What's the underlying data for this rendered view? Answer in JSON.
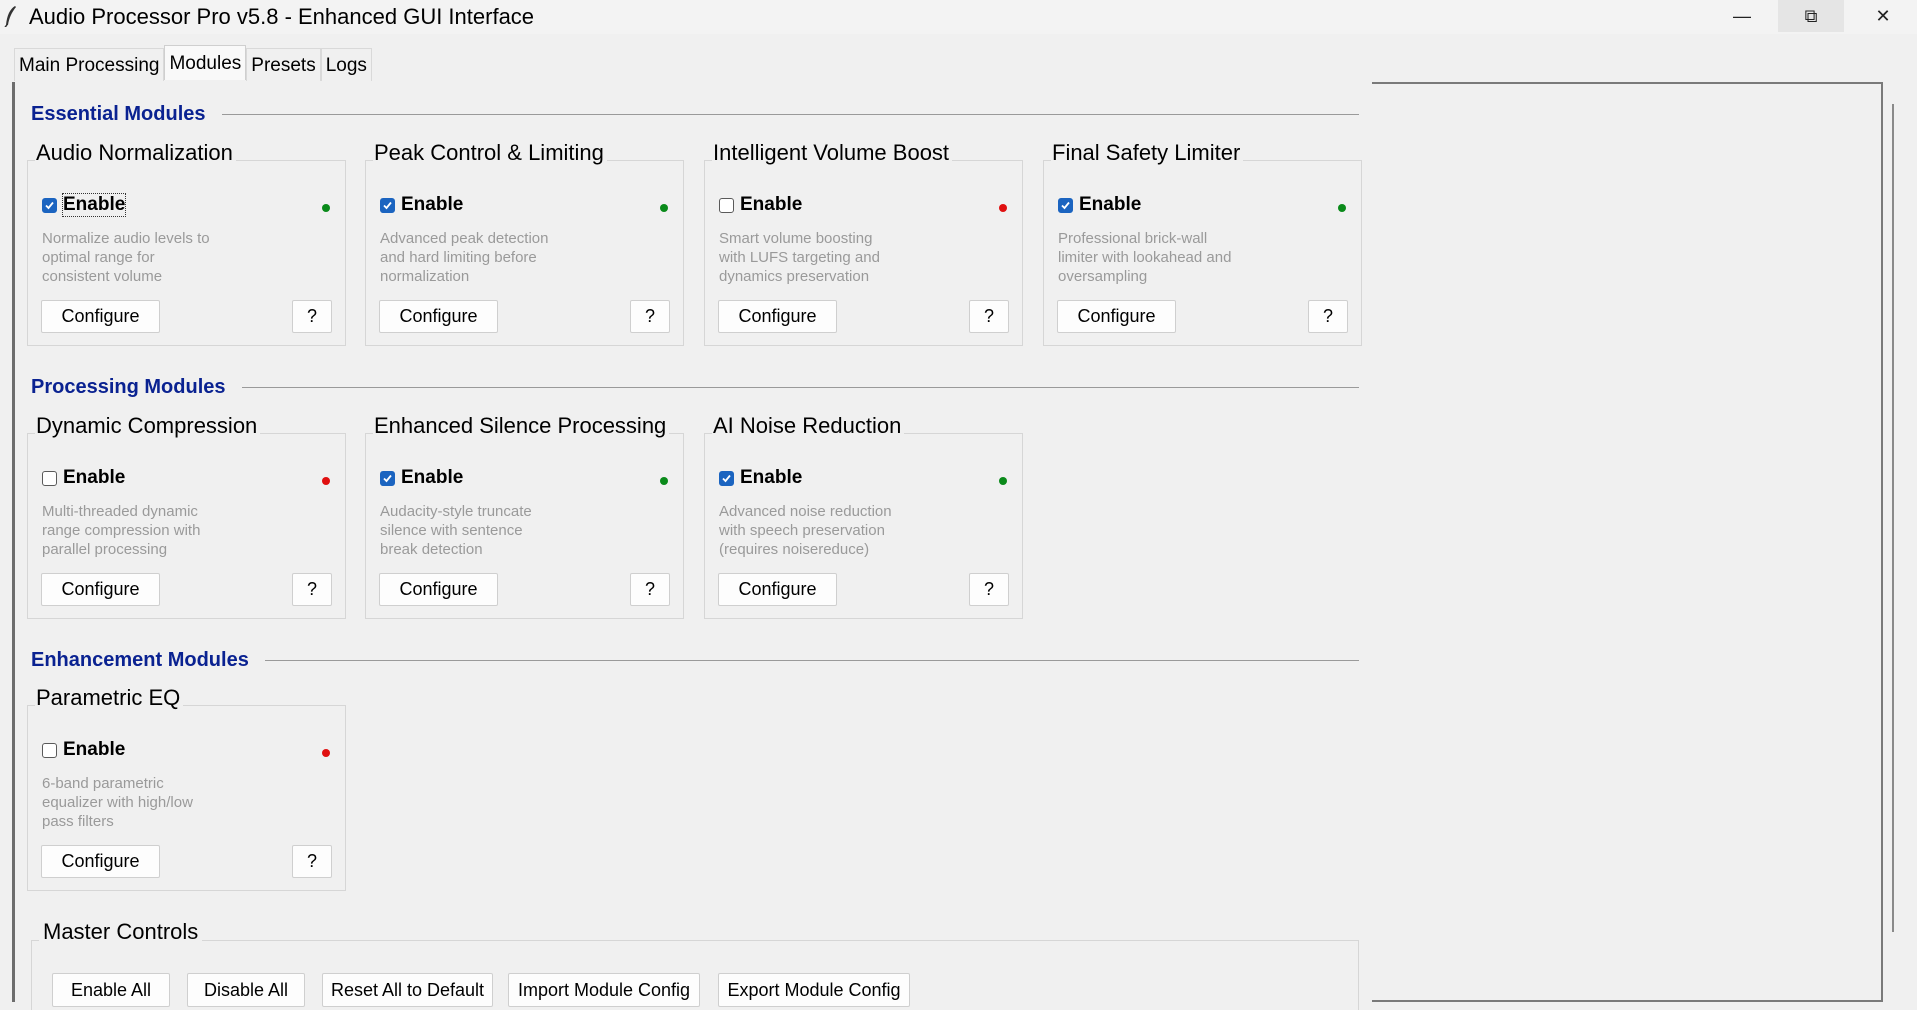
{
  "window": {
    "title": "Audio Processor Pro v5.8 - Enhanced GUI Interface",
    "minimize": "—",
    "maximize": "⧉",
    "close": "✕"
  },
  "tabs": [
    {
      "label": "Main Processing",
      "active": false
    },
    {
      "label": "Modules",
      "active": true
    },
    {
      "label": "Presets",
      "active": false
    },
    {
      "label": "Logs",
      "active": false
    }
  ],
  "colors": {
    "heading": "#0a2291",
    "status_on": "#0a8a1a",
    "status_off": "#e01010",
    "checkbox": "#1b64c0"
  },
  "sections": [
    {
      "title": "Essential Modules",
      "modules": [
        {
          "title": "Audio Normalization",
          "enable_label": "Enable",
          "enabled": true,
          "status": "on",
          "focused": true,
          "desc": [
            "Normalize audio levels to",
            "optimal range for",
            "consistent volume"
          ],
          "configure_label": "Configure",
          "help_label": "?"
        },
        {
          "title": "Peak Control & Limiting",
          "enable_label": "Enable",
          "enabled": true,
          "status": "on",
          "desc": [
            "Advanced peak detection",
            "and hard limiting before",
            "normalization"
          ],
          "configure_label": "Configure",
          "help_label": "?"
        },
        {
          "title": "Intelligent Volume Boost",
          "enable_label": "Enable",
          "enabled": false,
          "status": "off",
          "desc": [
            "Smart volume boosting",
            "with LUFS targeting and",
            "dynamics preservation"
          ],
          "configure_label": "Configure",
          "help_label": "?"
        },
        {
          "title": "Final Safety Limiter",
          "enable_label": "Enable",
          "enabled": true,
          "status": "on",
          "desc": [
            "Professional brick-wall",
            "limiter with lookahead and",
            "oversampling"
          ],
          "configure_label": "Configure",
          "help_label": "?"
        }
      ]
    },
    {
      "title": "Processing Modules",
      "modules": [
        {
          "title": "Dynamic Compression",
          "enable_label": "Enable",
          "enabled": false,
          "status": "off",
          "desc": [
            "Multi-threaded dynamic",
            "range compression with",
            "parallel processing"
          ],
          "configure_label": "Configure",
          "help_label": "?"
        },
        {
          "title": "Enhanced Silence Processing",
          "enable_label": "Enable",
          "enabled": true,
          "status": "on",
          "desc": [
            "Audacity-style truncate",
            "silence with sentence",
            "break detection"
          ],
          "configure_label": "Configure",
          "help_label": "?"
        },
        {
          "title": "AI Noise Reduction",
          "enable_label": "Enable",
          "enabled": true,
          "status": "on",
          "desc": [
            "Advanced noise reduction",
            "with speech preservation",
            "(requires noisereduce)"
          ],
          "configure_label": "Configure",
          "help_label": "?"
        }
      ]
    },
    {
      "title": "Enhancement Modules",
      "modules": [
        {
          "title": "Parametric EQ",
          "enable_label": "Enable",
          "enabled": false,
          "status": "off",
          "desc": [
            "6-band parametric",
            "equalizer with high/low",
            "pass filters"
          ],
          "configure_label": "Configure",
          "help_label": "?"
        }
      ]
    }
  ],
  "master": {
    "title": "Master Controls",
    "buttons": [
      "Enable All",
      "Disable All",
      "Reset All to Default",
      "Import Module Config",
      "Export Module Config"
    ]
  }
}
